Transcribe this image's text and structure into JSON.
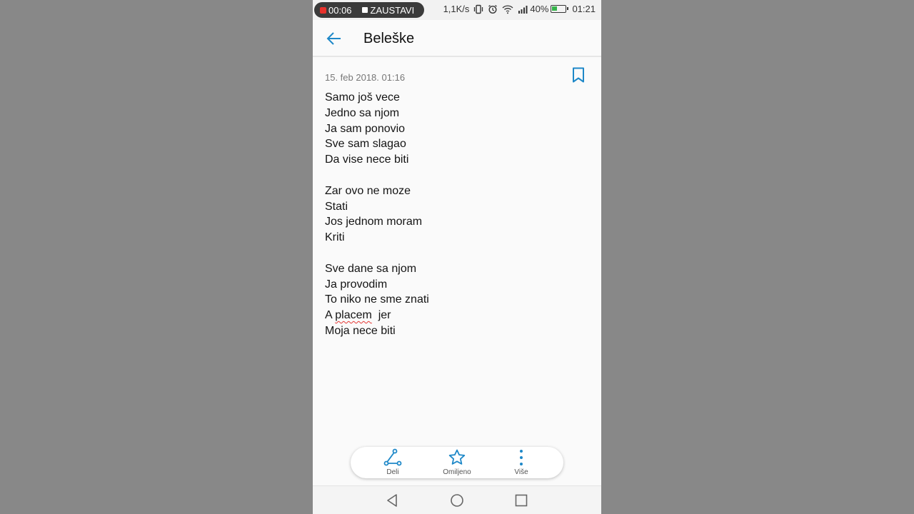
{
  "status_bar": {
    "record_time": "00:06",
    "stop_label": "ZAUSTAVI",
    "net_speed": "1,1K/s",
    "battery": "40%",
    "time": "01:21",
    "battery_level": 0.4,
    "battery_color": "#35b34a"
  },
  "app_bar": {
    "title": "Beleške",
    "back_icon": "arrow-left-icon"
  },
  "note": {
    "date": "15. feb 2018. 01:16",
    "bookmark_icon": "bookmark-icon",
    "lines": [
      "Samo još vece",
      "Jedno sa njom",
      "Ja sam ponovio",
      "Sve sam slagao",
      "Da vise nece biti",
      "",
      "Zar ovo ne moze",
      "Stati",
      "Jos jednom moram",
      "Kriti",
      "",
      "Sve dane sa njom",
      "Ja provodim",
      "To niko ne sme znati",
      "A placem  jer",
      "Moja nece biti"
    ],
    "line_14": {
      "prefix": "A ",
      "misspelled": "placem",
      "suffix": "  jer"
    }
  },
  "actions": [
    {
      "label": "Deli",
      "icon": "share-icon"
    },
    {
      "label": "Omiljeno",
      "icon": "star-icon"
    },
    {
      "label": "Više",
      "icon": "more-vertical-icon"
    }
  ],
  "colors": {
    "accent": "#1e88c8",
    "spell_error": "#e53935"
  }
}
